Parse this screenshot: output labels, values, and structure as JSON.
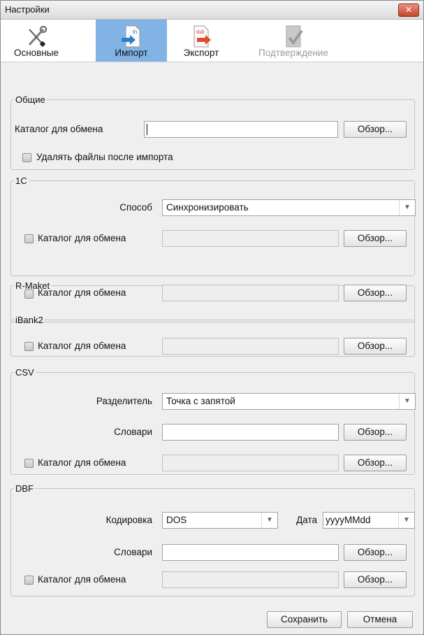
{
  "window": {
    "title": "Настройки"
  },
  "tabs": [
    {
      "label": "Основные",
      "icon": "wrench-screwdriver-icon",
      "active": false,
      "enabled": true
    },
    {
      "label": "Импорт",
      "icon": "import-file-icon",
      "icon_text": "in",
      "active": true,
      "enabled": true
    },
    {
      "label": "Экспорт",
      "icon": "export-file-icon",
      "icon_text": "out",
      "active": false,
      "enabled": true
    },
    {
      "label": "Подтверждение",
      "icon": "confirm-document-icon",
      "active": false,
      "enabled": false
    }
  ],
  "general": {
    "legend": "Общие",
    "exchange_dir_label": "Каталог для обмена",
    "exchange_dir_value": "",
    "browse": "Обзор...",
    "delete_after_import_label": "Удалять файлы после импорта",
    "delete_after_import_checked": false
  },
  "onec": {
    "legend": "1С",
    "method_label": "Способ",
    "method_value": "Синхронизировать",
    "exchange_dir_label": "Каталог для обмена",
    "browse": "Обзор..."
  },
  "rmaket": {
    "legend": "R-Maket",
    "exchange_dir_label": "Каталог для обмена",
    "browse": "Обзор..."
  },
  "ibank2": {
    "legend": "iBank2",
    "exchange_dir_label": "Каталог для обмена",
    "browse": "Обзор..."
  },
  "csv": {
    "legend": "CSV",
    "separator_label": "Разделитель",
    "separator_value": "Точка с запятой",
    "dicts_label": "Словари",
    "dicts_value": "",
    "dicts_browse": "Обзор...",
    "exchange_dir_label": "Каталог для обмена",
    "browse": "Обзор..."
  },
  "dbf": {
    "legend": "DBF",
    "encoding_label": "Кодировка",
    "encoding_value": "DOS",
    "date_label": "Дата",
    "date_value": "yyyyMMdd",
    "dicts_label": "Словари",
    "dicts_value": "",
    "dicts_browse": "Обзор...",
    "exchange_dir_label": "Каталог для обмена",
    "browse": "Обзор..."
  },
  "footer": {
    "save": "Сохранить",
    "cancel": "Отмена"
  },
  "colors": {
    "active_tab": "#82b3e5",
    "close_button": "#c7442c"
  }
}
